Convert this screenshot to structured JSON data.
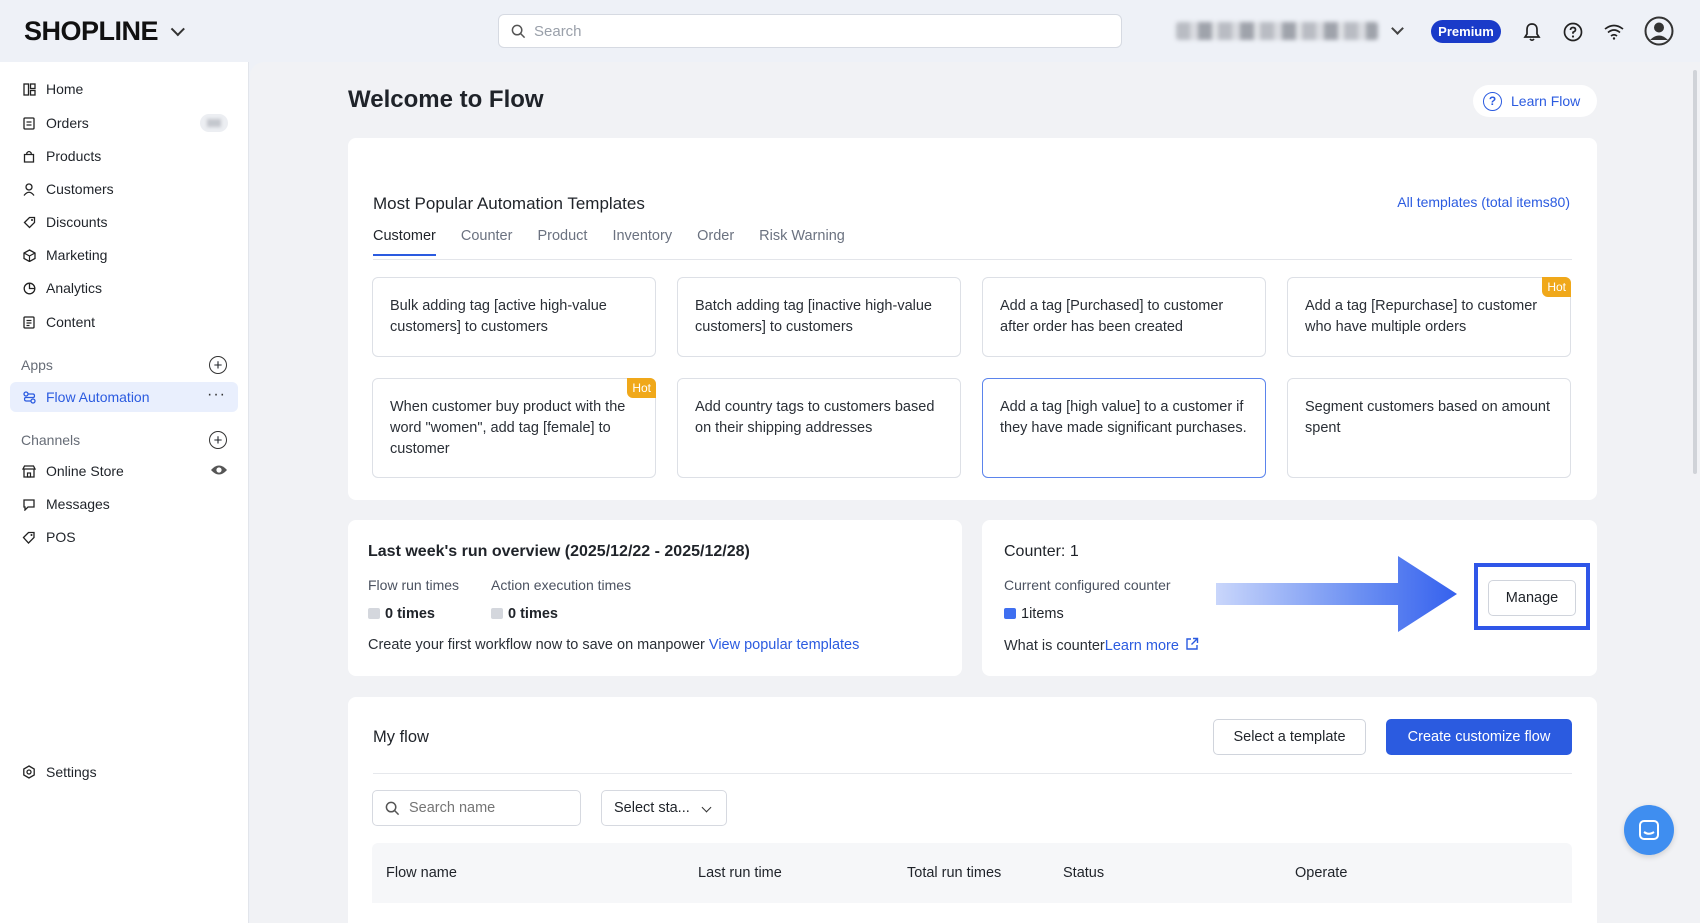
{
  "topbar": {
    "logo": "SHOPLINE",
    "search_placeholder": "Search",
    "premium_badge": "Premium"
  },
  "sidebar": {
    "items": [
      {
        "label": "Home",
        "icon": "home-icon"
      },
      {
        "label": "Orders",
        "icon": "orders-icon"
      },
      {
        "label": "Products",
        "icon": "products-icon"
      },
      {
        "label": "Customers",
        "icon": "customers-icon"
      },
      {
        "label": "Discounts",
        "icon": "discounts-icon"
      },
      {
        "label": "Marketing",
        "icon": "marketing-icon"
      },
      {
        "label": "Analytics",
        "icon": "analytics-icon"
      },
      {
        "label": "Content",
        "icon": "content-icon"
      }
    ],
    "apps_label": "Apps",
    "apps": [
      {
        "label": "Flow Automation",
        "icon": "flow-icon"
      }
    ],
    "channels_label": "Channels",
    "channels": [
      {
        "label": "Online Store",
        "icon": "store-icon"
      },
      {
        "label": "Messages",
        "icon": "messages-icon"
      },
      {
        "label": "POS",
        "icon": "pos-icon"
      }
    ],
    "settings_label": "Settings"
  },
  "main": {
    "title": "Welcome to Flow",
    "learn_flow": "Learn Flow",
    "templates": {
      "title": "Most Popular Automation Templates",
      "all_link": "All templates (total items80)",
      "tabs": [
        "Customer",
        "Counter",
        "Product",
        "Inventory",
        "Order",
        "Risk Warning"
      ],
      "active_tab": "Customer",
      "hot_label": "Hot",
      "cards": [
        "Bulk adding tag [active high-value customers] to customers",
        "Batch adding tag [inactive high-value customers] to customers",
        "Add a tag [Purchased] to customer after order has been created",
        "Add a tag [Repurchase] to customer who have multiple orders",
        "When customer buy product with the word \"women\", add tag [female] to customer",
        "Add country tags to customers based on their shipping addresses",
        "Add a tag [high value] to a customer if they have made significant purchases.",
        "Segment customers based on amount spent"
      ]
    },
    "overview": {
      "title": "Last week's run overview (2025/12/22 - 2025/12/28)",
      "flow_run_label": "Flow run times",
      "flow_run_value": "0 times",
      "action_label": "Action execution times",
      "action_value": "0 times",
      "cta_text": "Create your first workflow now to save on manpower",
      "cta_link": "View popular templates"
    },
    "counter": {
      "title": "Counter: 1",
      "configured_label": "Current configured counter",
      "items_value": "1items",
      "what_is": "What is counter",
      "learn_more": "Learn more",
      "manage_button": "Manage"
    },
    "my_flow": {
      "title": "My flow",
      "select_template": "Select a template",
      "create_flow": "Create customize flow",
      "search_placeholder": "Search name",
      "status_select": "Select sta...",
      "columns": [
        "Flow name",
        "Last run time",
        "Total run times",
        "Status",
        "Operate"
      ]
    }
  },
  "colors": {
    "accent": "#2b5be0",
    "hot": "#f0a81a",
    "premium": "#1a3bc9"
  }
}
